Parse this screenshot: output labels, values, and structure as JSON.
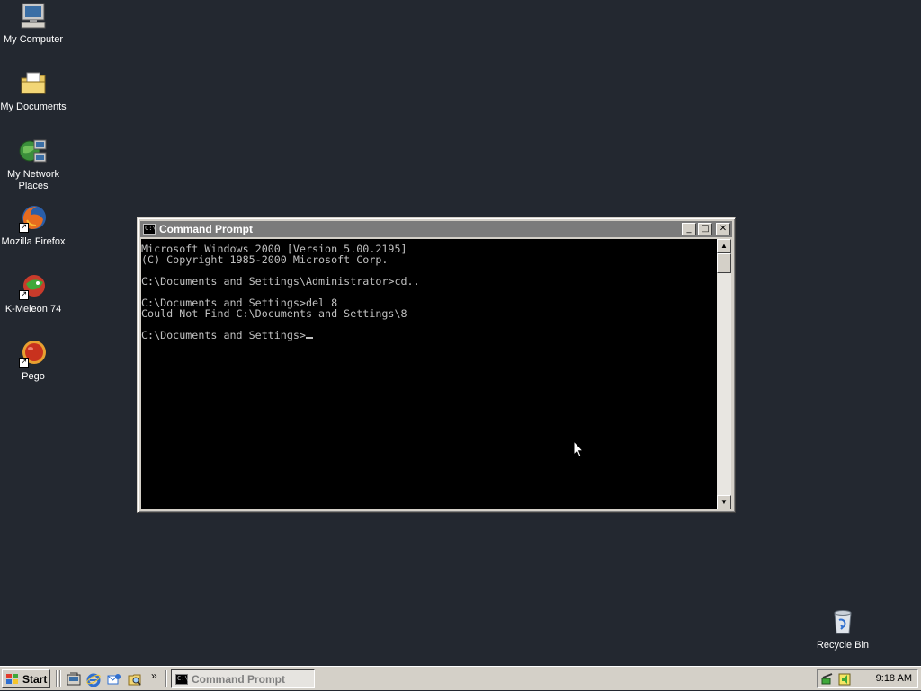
{
  "desktop": {
    "icons": [
      {
        "label": "My Computer",
        "icon": "my-computer-icon"
      },
      {
        "label": "My Documents",
        "icon": "my-documents-icon"
      },
      {
        "label": "My Network Places",
        "icon": "network-places-icon"
      },
      {
        "label": "Mozilla Firefox",
        "icon": "firefox-icon"
      },
      {
        "label": "K-Meleon 74",
        "icon": "k-meleon-icon"
      },
      {
        "label": "Pego",
        "icon": "pego-icon"
      },
      {
        "label": "Recycle Bin",
        "icon": "recycle-bin-icon"
      }
    ]
  },
  "window": {
    "title": "Command Prompt",
    "icon_text": "C:\\",
    "buttons": {
      "minimize": "_",
      "maximize": "□",
      "close": "✕"
    },
    "console_lines": [
      "Microsoft Windows 2000 [Version 5.00.2195]",
      "(C) Copyright 1985-2000 Microsoft Corp.",
      "",
      "C:\\Documents and Settings\\Administrator>cd..",
      "",
      "C:\\Documents and Settings>del 8",
      "Could Not Find C:\\Documents and Settings\\8",
      "",
      "C:\\Documents and Settings>"
    ],
    "scroll_up": "▲",
    "scroll_down": "▼"
  },
  "taskbar": {
    "start_label": "Start",
    "quick_launch": [
      "show-desktop-icon",
      "internet-explorer-icon",
      "outlook-express-icon",
      "windows-explorer-icon"
    ],
    "more_chevron": "»",
    "task_button_label": "Command Prompt",
    "clock": "9:18 AM"
  },
  "colors": {
    "desktop_bg": "#232830",
    "titlebar_inactive": "#7b7b7b",
    "console_bg": "#000000",
    "console_text": "#c0c0c0"
  }
}
